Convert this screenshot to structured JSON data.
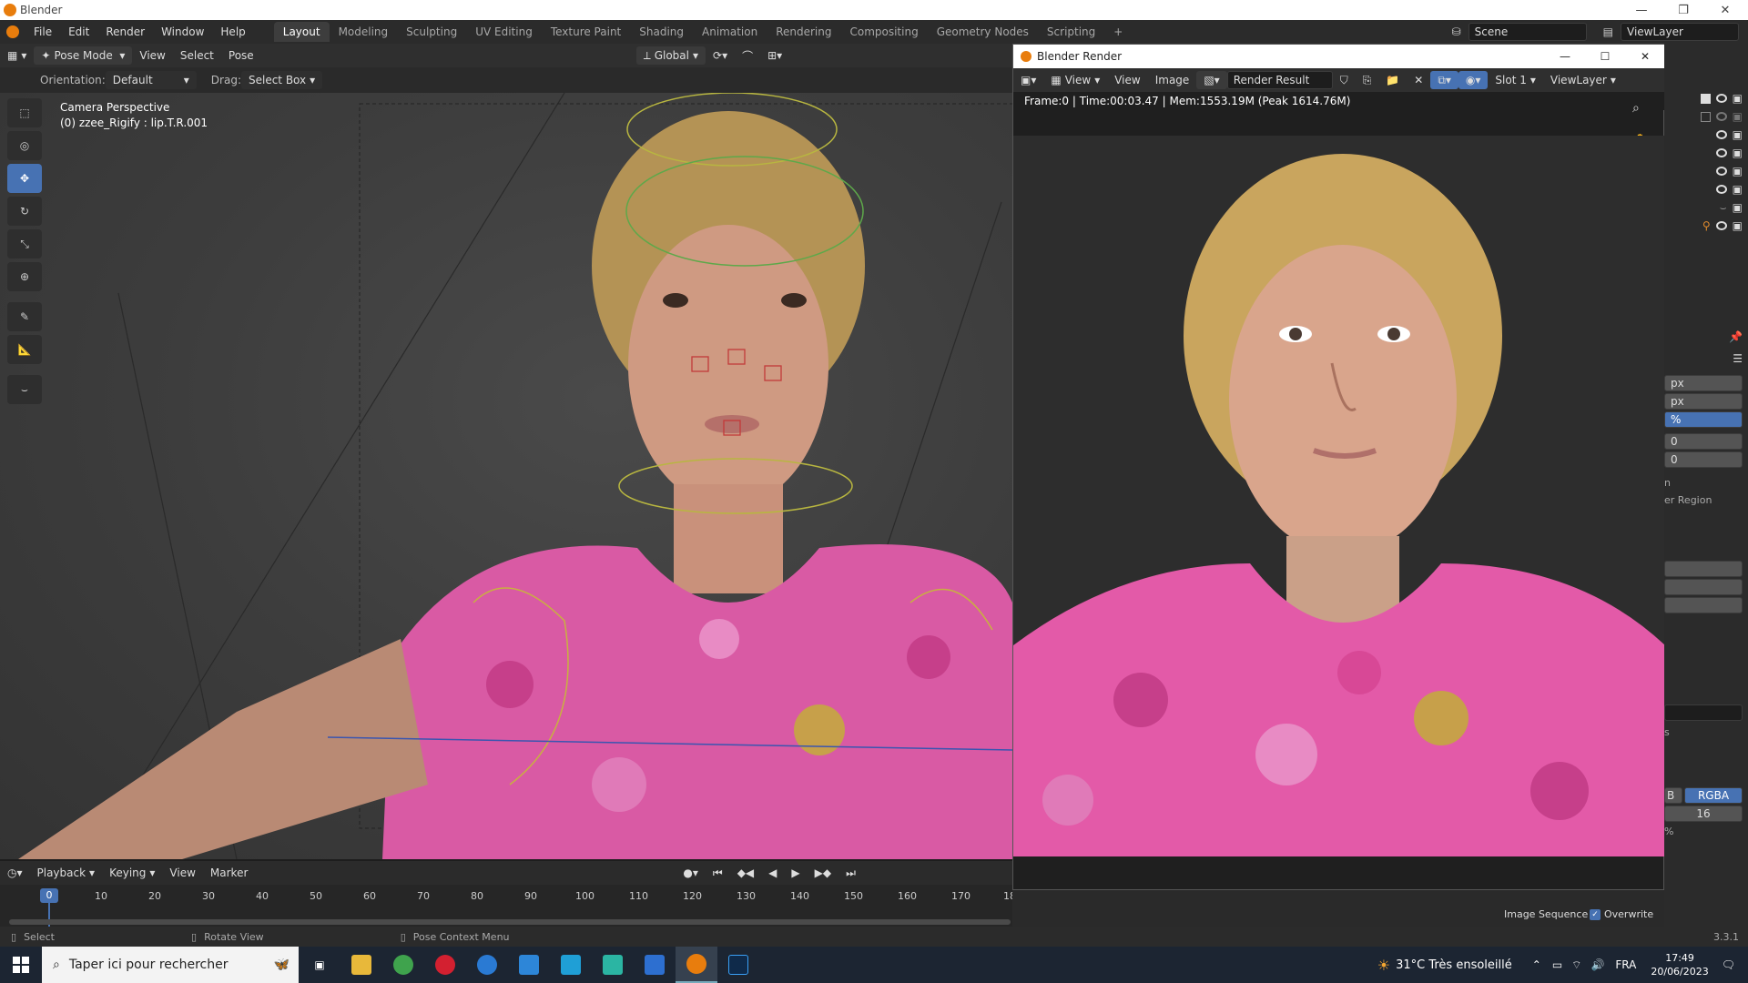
{
  "window": {
    "title": "Blender"
  },
  "menu": [
    "File",
    "Edit",
    "Render",
    "Window",
    "Help"
  ],
  "workspaces": [
    "Layout",
    "Modeling",
    "Sculpting",
    "UV Editing",
    "Texture Paint",
    "Shading",
    "Animation",
    "Rendering",
    "Compositing",
    "Geometry Nodes",
    "Scripting"
  ],
  "active_workspace": "Layout",
  "scene": {
    "name": "Scene",
    "view_layer": "ViewLayer"
  },
  "viewport_header": {
    "mode": "Pose Mode",
    "menus": [
      "View",
      "Select",
      "Pose"
    ],
    "transform": "Global"
  },
  "tool_settings": {
    "orientation_label": "Orientation:",
    "orientation_value": "Default",
    "drag_label": "Drag:",
    "drag_value": "Select Box"
  },
  "viewport": {
    "camera": "Camera Perspective",
    "object": "(0) zzee_Rigify : lip.T.R.001"
  },
  "render_window": {
    "title": "Blender Render",
    "menus": [
      "View",
      "View",
      "Image"
    ],
    "image": "Render Result",
    "slot": "Slot 1",
    "view_layer": "ViewLayer",
    "info": "Frame:0 | Time:00:03.47 | Mem:1553.19M (Peak 1614.76M)"
  },
  "timeline": {
    "menus": [
      "Playback",
      "Keying",
      "View",
      "Marker"
    ],
    "current_frame": "0",
    "ticks": [
      "10",
      "20",
      "30",
      "40",
      "50",
      "60",
      "70",
      "80",
      "90",
      "100",
      "110",
      "120",
      "130",
      "140",
      "150",
      "160",
      "170",
      "18"
    ]
  },
  "right_panel": {
    "fields": [
      "px",
      "px",
      "%",
      "0",
      "0"
    ],
    "partial_texts": [
      "n",
      "er Region",
      "s"
    ],
    "color_mode": "RGBA",
    "color_mode_prev": "B",
    "color_depth": "16",
    "pct": "%",
    "image_sequence": "Image Sequence",
    "overwrite": "Overwrite"
  },
  "status": {
    "select": "Select",
    "rotate": "Rotate View",
    "context": "Pose Context Menu",
    "version": "3.3.1"
  },
  "taskbar": {
    "search_placeholder": "Taper ici pour rechercher",
    "weather": "31°C Très ensoleillé",
    "lang": "FRA",
    "time": "17:49",
    "date": "20/06/2023"
  },
  "colors": {
    "accent": "#4772b3",
    "shirt": "#e35aa8",
    "hair": "#c9a55e",
    "skin": "#d9a58c"
  }
}
